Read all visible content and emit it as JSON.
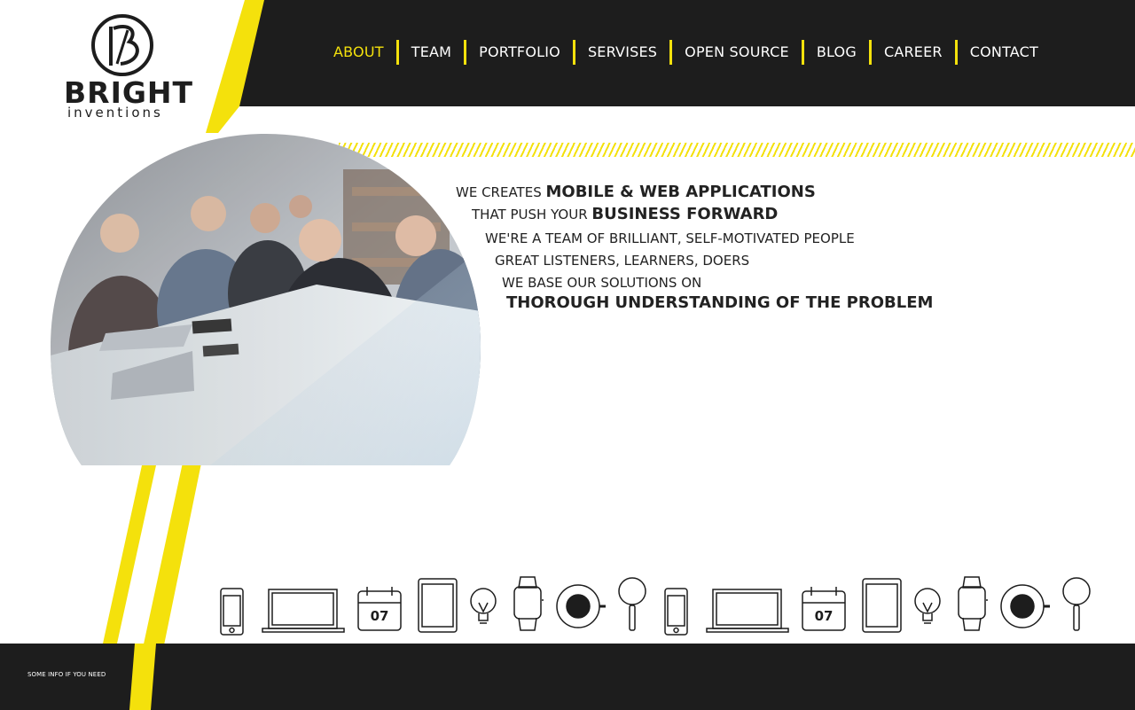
{
  "brand": {
    "name": "BRIGHT",
    "tagline": "inventions",
    "monogram": "B"
  },
  "colors": {
    "accent": "#f4e10c",
    "dark": "#1d1d1d",
    "text": "#222222"
  },
  "nav": {
    "items": [
      {
        "label": "ABOUT",
        "active": true
      },
      {
        "label": "TEAM"
      },
      {
        "label": "PORTFOLIO"
      },
      {
        "label": "SERVISES"
      },
      {
        "label": "OPEN SOURCE"
      },
      {
        "label": "BLOG"
      },
      {
        "label": "CAREER"
      },
      {
        "label": "CONTACT"
      }
    ]
  },
  "hero": {
    "line1_a": "WE CREATES ",
    "line1_b": "MOBILE & WEB APPLICATIONS",
    "line2_a": "THAT PUSH YOUR ",
    "line2_b": "BUSINESS FORWARD",
    "line3": "WE'RE A TEAM OF BRILLIANT, SELF-MOTIVATED PEOPLE",
    "line4": "GREAT LISTENERS, LEARNERS, DOERS",
    "line5": "WE BASE OUR SOLUTIONS ON",
    "line6": "THOROUGH UNDERSTANDING OF THE PROBLEM"
  },
  "icons": {
    "items": [
      "phone-icon",
      "laptop-icon",
      "calendar-icon",
      "tablet-icon",
      "lightbulb-icon",
      "smartwatch-icon",
      "coffee-cup-icon",
      "magnifier-icon",
      "phone-icon",
      "laptop-icon",
      "calendar-icon",
      "tablet-icon",
      "lightbulb-icon",
      "smartwatch-icon",
      "coffee-cup-icon",
      "magnifier-icon"
    ],
    "calendar_day": "07"
  },
  "footer": {
    "text": "SOME INFO IF YOU NEED"
  }
}
